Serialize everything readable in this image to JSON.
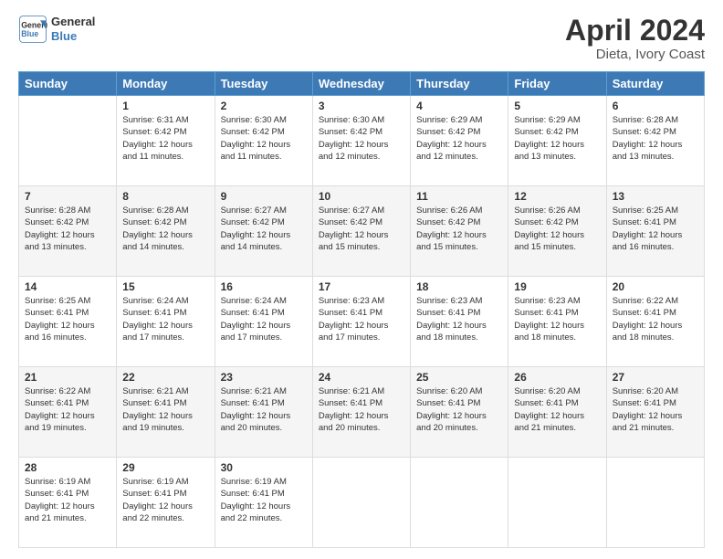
{
  "header": {
    "logo_line1": "General",
    "logo_line2": "Blue",
    "title": "April 2024",
    "subtitle": "Dieta, Ivory Coast"
  },
  "columns": [
    "Sunday",
    "Monday",
    "Tuesday",
    "Wednesday",
    "Thursday",
    "Friday",
    "Saturday"
  ],
  "weeks": [
    [
      {
        "day": "",
        "sunrise": "",
        "sunset": "",
        "daylight": ""
      },
      {
        "day": "1",
        "sunrise": "Sunrise: 6:31 AM",
        "sunset": "Sunset: 6:42 PM",
        "daylight": "Daylight: 12 hours and 11 minutes."
      },
      {
        "day": "2",
        "sunrise": "Sunrise: 6:30 AM",
        "sunset": "Sunset: 6:42 PM",
        "daylight": "Daylight: 12 hours and 11 minutes."
      },
      {
        "day": "3",
        "sunrise": "Sunrise: 6:30 AM",
        "sunset": "Sunset: 6:42 PM",
        "daylight": "Daylight: 12 hours and 12 minutes."
      },
      {
        "day": "4",
        "sunrise": "Sunrise: 6:29 AM",
        "sunset": "Sunset: 6:42 PM",
        "daylight": "Daylight: 12 hours and 12 minutes."
      },
      {
        "day": "5",
        "sunrise": "Sunrise: 6:29 AM",
        "sunset": "Sunset: 6:42 PM",
        "daylight": "Daylight: 12 hours and 13 minutes."
      },
      {
        "day": "6",
        "sunrise": "Sunrise: 6:28 AM",
        "sunset": "Sunset: 6:42 PM",
        "daylight": "Daylight: 12 hours and 13 minutes."
      }
    ],
    [
      {
        "day": "7",
        "sunrise": "Sunrise: 6:28 AM",
        "sunset": "Sunset: 6:42 PM",
        "daylight": "Daylight: 12 hours and 13 minutes."
      },
      {
        "day": "8",
        "sunrise": "Sunrise: 6:28 AM",
        "sunset": "Sunset: 6:42 PM",
        "daylight": "Daylight: 12 hours and 14 minutes."
      },
      {
        "day": "9",
        "sunrise": "Sunrise: 6:27 AM",
        "sunset": "Sunset: 6:42 PM",
        "daylight": "Daylight: 12 hours and 14 minutes."
      },
      {
        "day": "10",
        "sunrise": "Sunrise: 6:27 AM",
        "sunset": "Sunset: 6:42 PM",
        "daylight": "Daylight: 12 hours and 15 minutes."
      },
      {
        "day": "11",
        "sunrise": "Sunrise: 6:26 AM",
        "sunset": "Sunset: 6:42 PM",
        "daylight": "Daylight: 12 hours and 15 minutes."
      },
      {
        "day": "12",
        "sunrise": "Sunrise: 6:26 AM",
        "sunset": "Sunset: 6:42 PM",
        "daylight": "Daylight: 12 hours and 15 minutes."
      },
      {
        "day": "13",
        "sunrise": "Sunrise: 6:25 AM",
        "sunset": "Sunset: 6:41 PM",
        "daylight": "Daylight: 12 hours and 16 minutes."
      }
    ],
    [
      {
        "day": "14",
        "sunrise": "Sunrise: 6:25 AM",
        "sunset": "Sunset: 6:41 PM",
        "daylight": "Daylight: 12 hours and 16 minutes."
      },
      {
        "day": "15",
        "sunrise": "Sunrise: 6:24 AM",
        "sunset": "Sunset: 6:41 PM",
        "daylight": "Daylight: 12 hours and 17 minutes."
      },
      {
        "day": "16",
        "sunrise": "Sunrise: 6:24 AM",
        "sunset": "Sunset: 6:41 PM",
        "daylight": "Daylight: 12 hours and 17 minutes."
      },
      {
        "day": "17",
        "sunrise": "Sunrise: 6:23 AM",
        "sunset": "Sunset: 6:41 PM",
        "daylight": "Daylight: 12 hours and 17 minutes."
      },
      {
        "day": "18",
        "sunrise": "Sunrise: 6:23 AM",
        "sunset": "Sunset: 6:41 PM",
        "daylight": "Daylight: 12 hours and 18 minutes."
      },
      {
        "day": "19",
        "sunrise": "Sunrise: 6:23 AM",
        "sunset": "Sunset: 6:41 PM",
        "daylight": "Daylight: 12 hours and 18 minutes."
      },
      {
        "day": "20",
        "sunrise": "Sunrise: 6:22 AM",
        "sunset": "Sunset: 6:41 PM",
        "daylight": "Daylight: 12 hours and 18 minutes."
      }
    ],
    [
      {
        "day": "21",
        "sunrise": "Sunrise: 6:22 AM",
        "sunset": "Sunset: 6:41 PM",
        "daylight": "Daylight: 12 hours and 19 minutes."
      },
      {
        "day": "22",
        "sunrise": "Sunrise: 6:21 AM",
        "sunset": "Sunset: 6:41 PM",
        "daylight": "Daylight: 12 hours and 19 minutes."
      },
      {
        "day": "23",
        "sunrise": "Sunrise: 6:21 AM",
        "sunset": "Sunset: 6:41 PM",
        "daylight": "Daylight: 12 hours and 20 minutes."
      },
      {
        "day": "24",
        "sunrise": "Sunrise: 6:21 AM",
        "sunset": "Sunset: 6:41 PM",
        "daylight": "Daylight: 12 hours and 20 minutes."
      },
      {
        "day": "25",
        "sunrise": "Sunrise: 6:20 AM",
        "sunset": "Sunset: 6:41 PM",
        "daylight": "Daylight: 12 hours and 20 minutes."
      },
      {
        "day": "26",
        "sunrise": "Sunrise: 6:20 AM",
        "sunset": "Sunset: 6:41 PM",
        "daylight": "Daylight: 12 hours and 21 minutes."
      },
      {
        "day": "27",
        "sunrise": "Sunrise: 6:20 AM",
        "sunset": "Sunset: 6:41 PM",
        "daylight": "Daylight: 12 hours and 21 minutes."
      }
    ],
    [
      {
        "day": "28",
        "sunrise": "Sunrise: 6:19 AM",
        "sunset": "Sunset: 6:41 PM",
        "daylight": "Daylight: 12 hours and 21 minutes."
      },
      {
        "day": "29",
        "sunrise": "Sunrise: 6:19 AM",
        "sunset": "Sunset: 6:41 PM",
        "daylight": "Daylight: 12 hours and 22 minutes."
      },
      {
        "day": "30",
        "sunrise": "Sunrise: 6:19 AM",
        "sunset": "Sunset: 6:41 PM",
        "daylight": "Daylight: 12 hours and 22 minutes."
      },
      {
        "day": "",
        "sunrise": "",
        "sunset": "",
        "daylight": ""
      },
      {
        "day": "",
        "sunrise": "",
        "sunset": "",
        "daylight": ""
      },
      {
        "day": "",
        "sunrise": "",
        "sunset": "",
        "daylight": ""
      },
      {
        "day": "",
        "sunrise": "",
        "sunset": "",
        "daylight": ""
      }
    ]
  ]
}
